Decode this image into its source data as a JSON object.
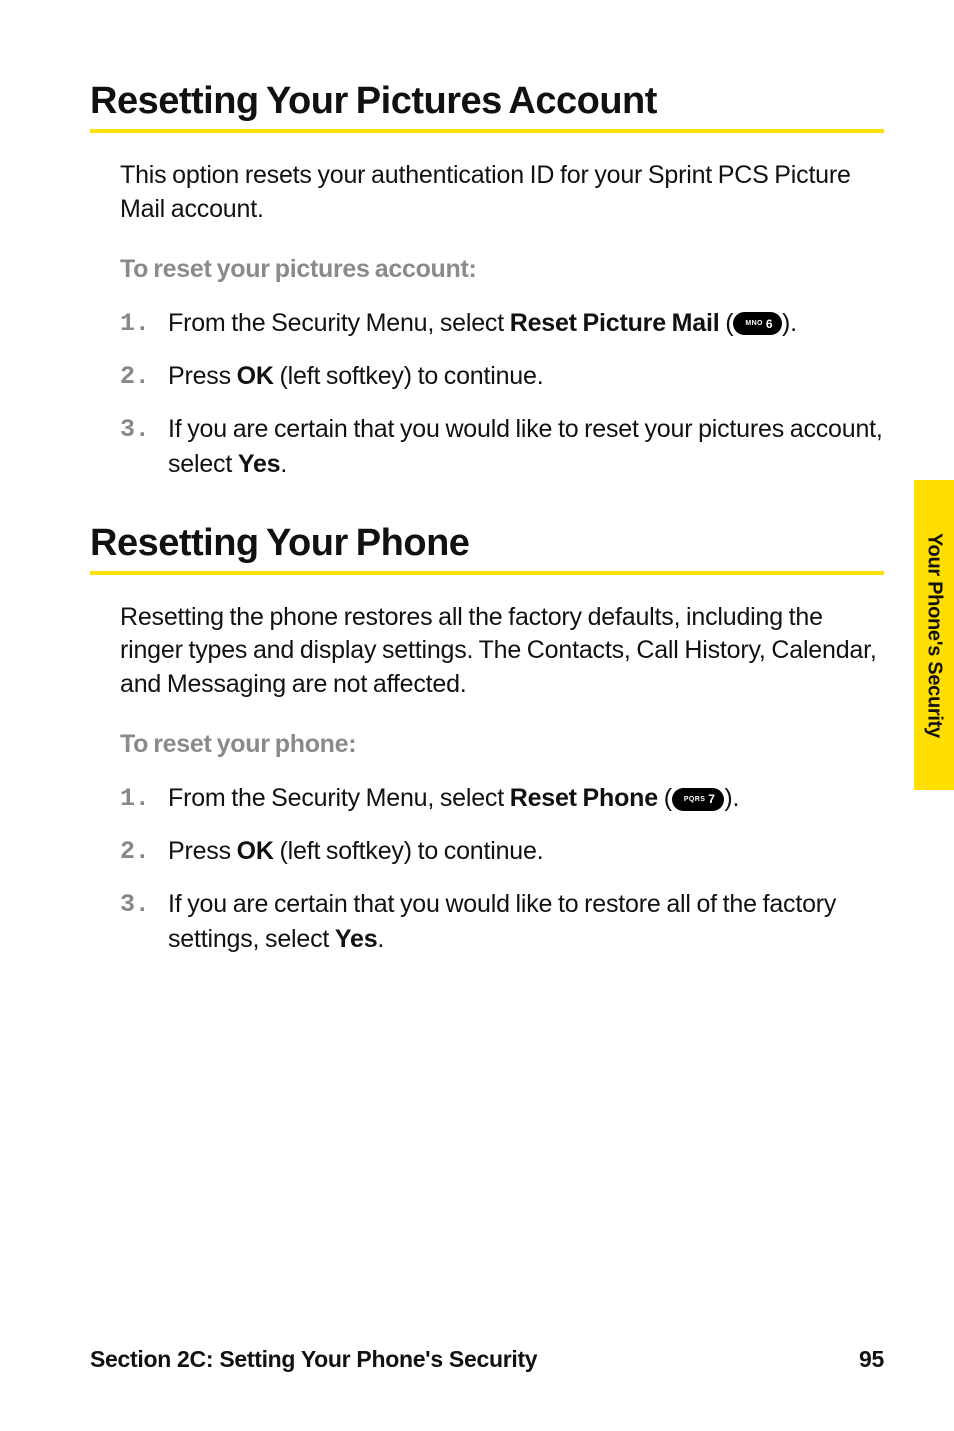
{
  "side_tab": "Your Phone's Security",
  "footer": {
    "section_label": "Section 2C: Setting Your Phone's Security",
    "page_number": "95"
  },
  "sections": [
    {
      "title": "Resetting Your Pictures Account",
      "intro": "This option resets your authentication ID for your Sprint PCS Picture Mail account.",
      "subhead": "To reset your pictures account:",
      "steps": [
        {
          "num": "1.",
          "pre": "From the Security Menu, select ",
          "bold": "Reset Picture Mail",
          "paren_open": " (",
          "key_abc": "MNO",
          "key_digit": "6",
          "paren_close": ")."
        },
        {
          "num": "2.",
          "pre": "Press ",
          "bold": "OK",
          "post": " (left softkey) to continue."
        },
        {
          "num": "3.",
          "pre": "If you are certain that you would like to reset your pictures account, select ",
          "bold": "Yes",
          "post": "."
        }
      ]
    },
    {
      "title": "Resetting Your Phone",
      "intro": "Resetting the phone restores all the factory defaults, including the ringer types and display settings. The Contacts, Call History, Calendar, and Messaging are not affected.",
      "subhead": "To reset your phone:",
      "steps": [
        {
          "num": "1.",
          "pre": "From the Security Menu, select ",
          "bold": "Reset Phone",
          "paren_open": " (",
          "key_abc": "PQRS",
          "key_digit": "7",
          "paren_close": ")."
        },
        {
          "num": "2.",
          "pre": "Press ",
          "bold": "OK",
          "post": " (left softkey) to continue."
        },
        {
          "num": "3.",
          "pre": "If you are certain that you would like to restore all of the factory settings, select ",
          "bold": "Yes",
          "post": "."
        }
      ]
    }
  ]
}
